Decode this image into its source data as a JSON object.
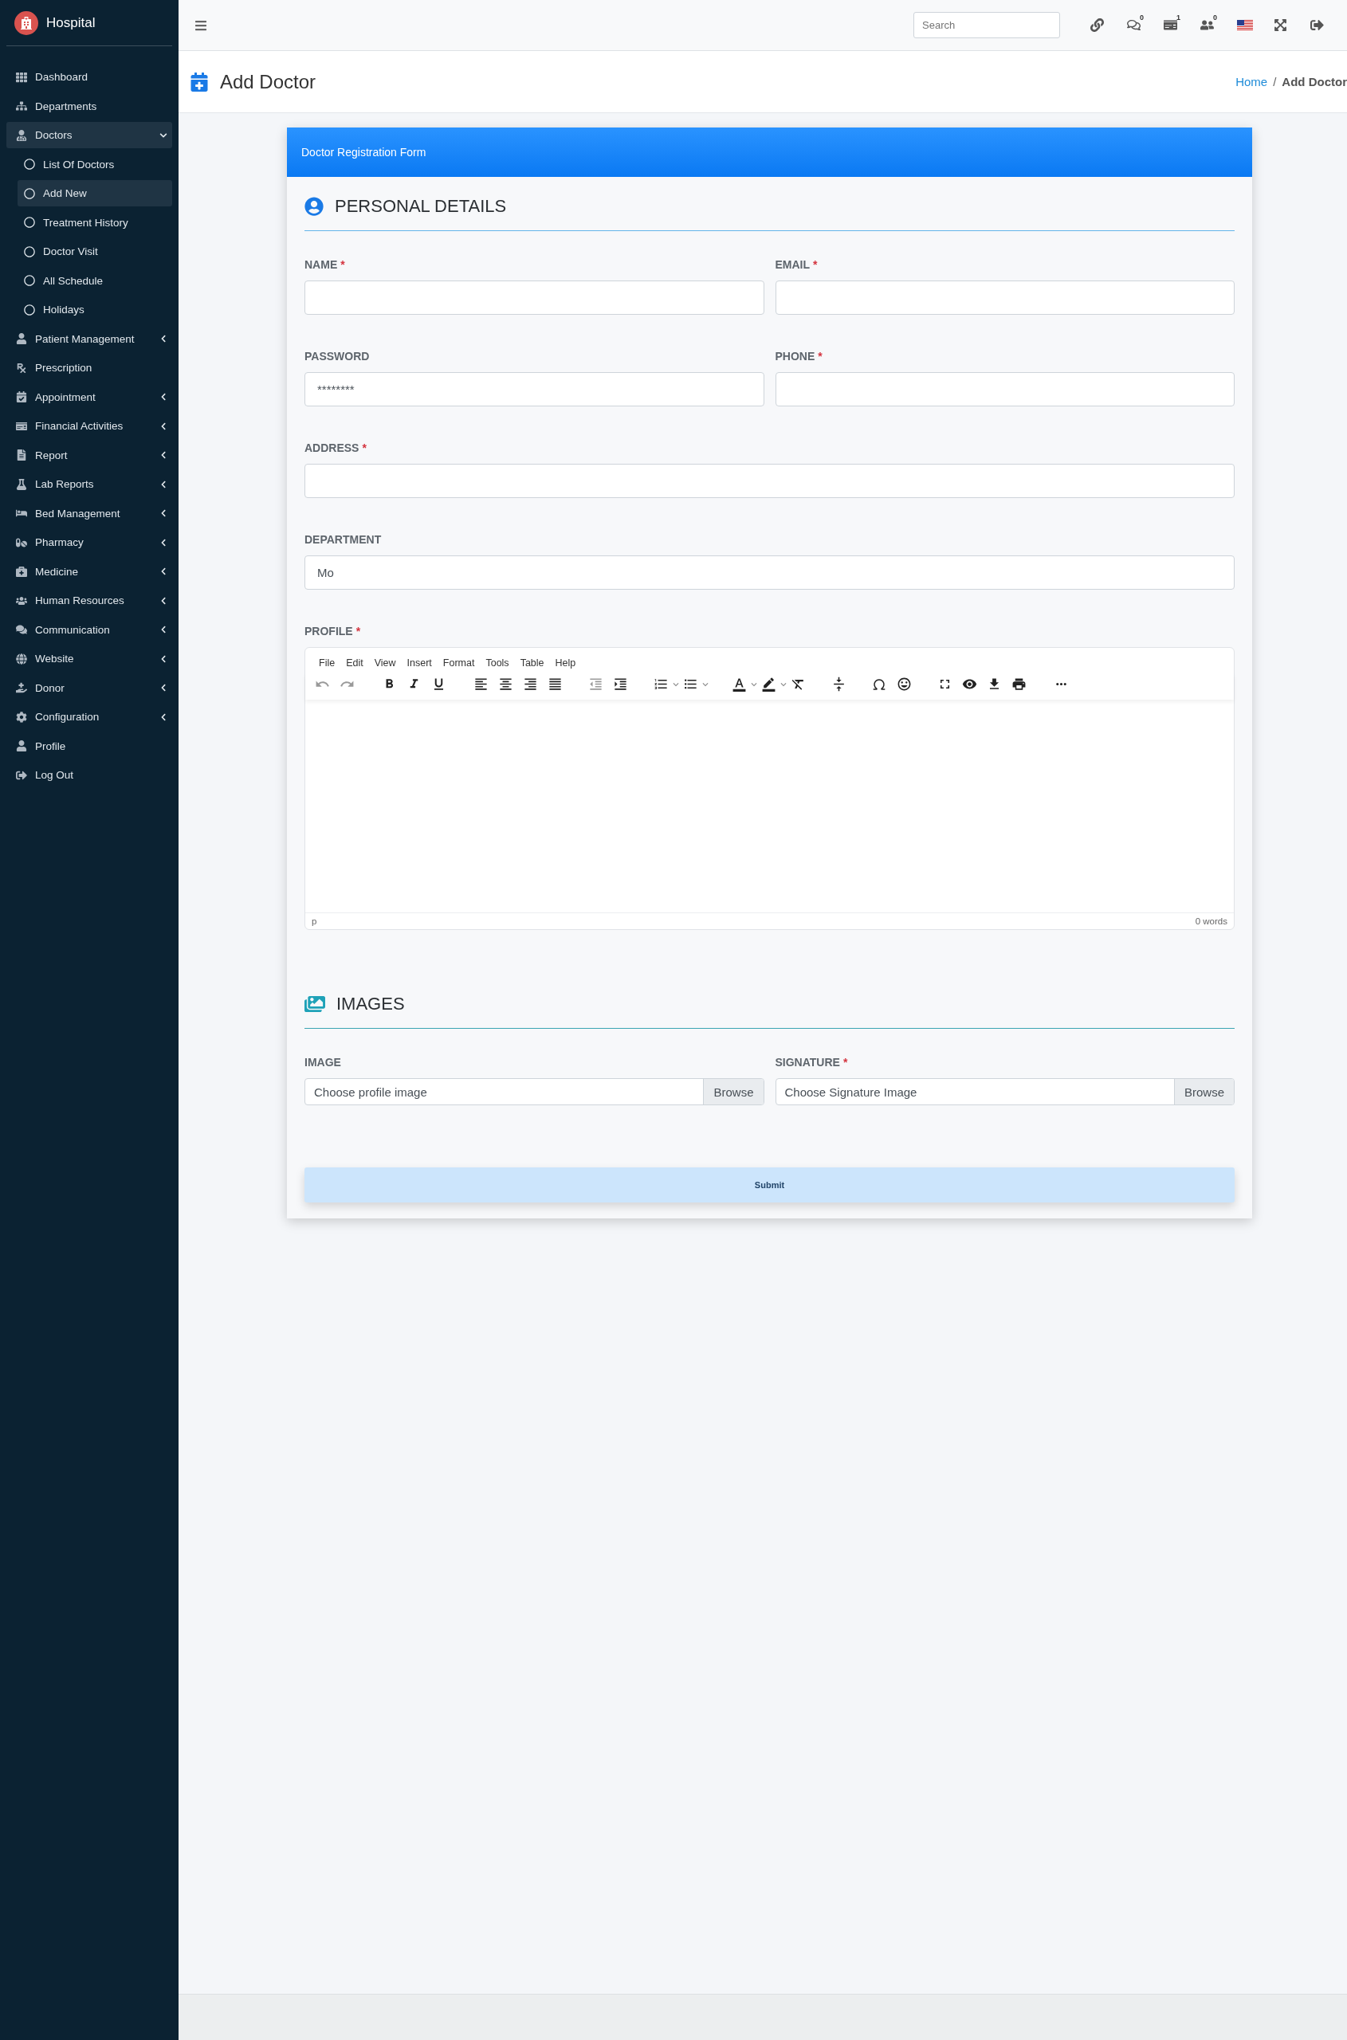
{
  "sidebar": {
    "brand": "Hospital",
    "items": [
      {
        "label": "Dashboard",
        "selected": false
      },
      {
        "label": "Departments",
        "selected": false
      },
      {
        "label": "Doctors",
        "selected": true,
        "expanded": true,
        "children": [
          {
            "label": "List Of Doctors",
            "selected": false
          },
          {
            "label": "Add New",
            "selected": true
          },
          {
            "label": "Treatment History",
            "selected": false
          },
          {
            "label": "Doctor Visit",
            "selected": false
          },
          {
            "label": "All Schedule",
            "selected": false
          },
          {
            "label": "Holidays",
            "selected": false
          }
        ]
      },
      {
        "label": "Patient Management",
        "selected": false,
        "expanded": false
      },
      {
        "label": "Prescription",
        "selected": false
      },
      {
        "label": "Appointment",
        "selected": false,
        "expanded": false
      },
      {
        "label": "Financial Activities",
        "selected": false,
        "expanded": false
      },
      {
        "label": "Report",
        "selected": false,
        "expanded": false
      },
      {
        "label": "Lab Reports",
        "selected": false,
        "expanded": false
      },
      {
        "label": "Bed Management",
        "selected": false,
        "expanded": false
      },
      {
        "label": "Pharmacy",
        "selected": false,
        "expanded": false
      },
      {
        "label": "Medicine",
        "selected": false,
        "expanded": false
      },
      {
        "label": "Human Resources",
        "selected": false,
        "expanded": false
      },
      {
        "label": "Communication",
        "selected": false,
        "expanded": false
      },
      {
        "label": "Website",
        "selected": false,
        "expanded": false
      },
      {
        "label": "Donor",
        "selected": false,
        "expanded": false
      },
      {
        "label": "Configuration",
        "selected": false,
        "expanded": false
      },
      {
        "label": "Profile",
        "selected": false
      },
      {
        "label": "Log Out",
        "selected": false
      }
    ]
  },
  "topbar": {
    "search": {
      "placeholder": "Search"
    },
    "icons": [
      {
        "kind": "link"
      },
      {
        "kind": "messages",
        "badge": "0"
      },
      {
        "kind": "payments",
        "badge": "1"
      },
      {
        "kind": "users",
        "badge": "0"
      },
      {
        "kind": "flag"
      },
      {
        "kind": "fullscreen"
      },
      {
        "kind": "logout"
      }
    ]
  },
  "page_header": {
    "title": "Add Doctor",
    "breadcrumb": [
      {
        "label": "Home",
        "kind": "link"
      },
      {
        "label": "Add Doctor",
        "kind": "current"
      }
    ],
    "separator": "/"
  },
  "form": {
    "title": "Doctor Registration Form",
    "required_mark": "*",
    "personal": {
      "heading": "PERSONAL DETAILS",
      "fields": [
        {
          "label": "NAME",
          "required": true,
          "kind": "half"
        },
        {
          "label": "EMAIL",
          "required": true,
          "kind": "half"
        },
        {
          "label": "PASSWORD",
          "required": false,
          "kind": "half",
          "value": "********"
        },
        {
          "label": "PHONE",
          "required": true,
          "kind": "half"
        },
        {
          "label": "ADDRESS",
          "required": true,
          "kind": "full"
        },
        {
          "label": "DEPARTMENT",
          "required": false,
          "kind": "full",
          "value": "Mo"
        }
      ]
    },
    "profile": {
      "label": "PROFILE",
      "required": true,
      "menu": [
        "File",
        "Edit",
        "View",
        "Insert",
        "Format",
        "Tools",
        "Table",
        "Help"
      ],
      "status_path": "p",
      "word_count": "0 words"
    },
    "images": {
      "heading": "IMAGES",
      "fields": [
        {
          "label": "IMAGE",
          "required": false,
          "placeholder": "Choose profile image",
          "button": "Browse"
        },
        {
          "label": "SIGNATURE",
          "required": true,
          "placeholder": "Choose Signature Image",
          "button": "Browse"
        }
      ]
    },
    "submit": "Submit"
  }
}
